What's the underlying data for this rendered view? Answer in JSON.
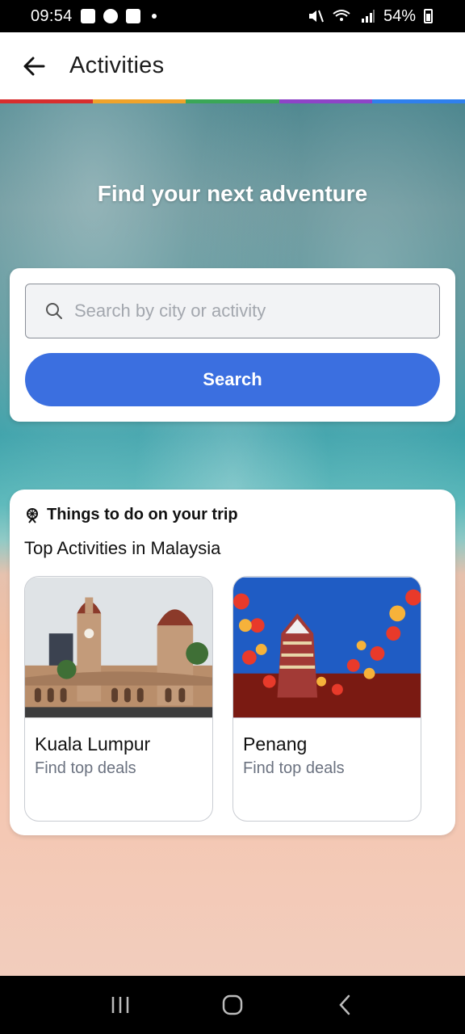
{
  "status_bar": {
    "time": "09:54",
    "battery": "54%"
  },
  "app_bar": {
    "title": "Activities"
  },
  "hero": {
    "title": "Find your next adventure"
  },
  "search": {
    "placeholder": "Search by city or activity",
    "value": "",
    "button_label": "Search"
  },
  "activities": {
    "section_title": "Things to do on your trip",
    "subtitle": "Top Activities in Malaysia",
    "cards": [
      {
        "name": "Kuala Lumpur",
        "subtitle": "Find top deals"
      },
      {
        "name": "Penang",
        "subtitle": "Find top deals"
      }
    ]
  },
  "colors": {
    "accent": "#3b6fe0",
    "rainbow": [
      "#d72e2e",
      "#f0a32a",
      "#3aa757",
      "#8e44c7",
      "#2f80ed"
    ]
  },
  "icons": {
    "back": "arrow-left-icon",
    "search": "search-icon",
    "section": "ferris-wheel-icon"
  }
}
